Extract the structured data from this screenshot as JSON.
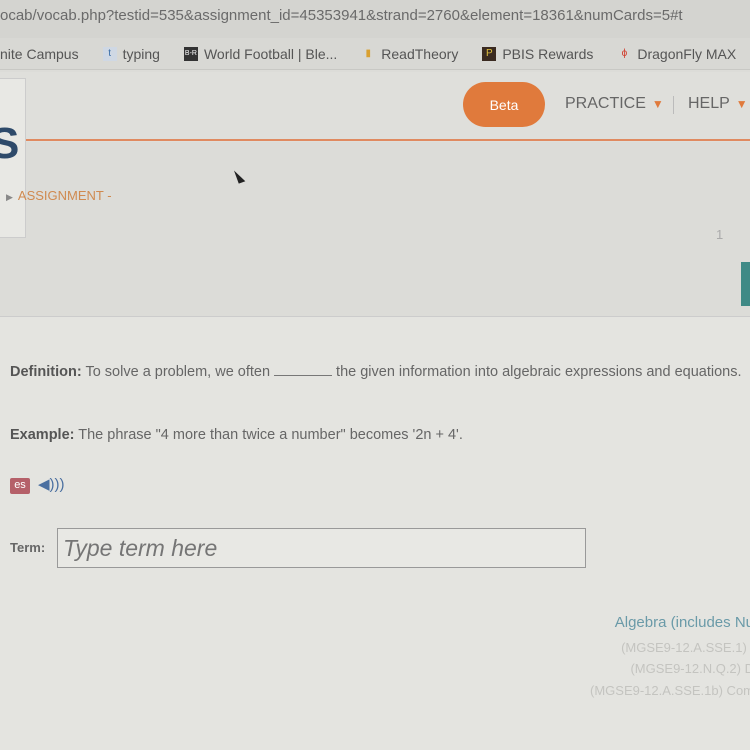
{
  "browser": {
    "url": "ocab/vocab.php?testid=535&assignment_id=45353941&strand=2760&element=18361&numCards=5#t",
    "bookmarks": [
      {
        "label": "nite Campus",
        "icon": ""
      },
      {
        "label": "typing",
        "icon": "t"
      },
      {
        "label": "World Football | Ble...",
        "icon": "B-R"
      },
      {
        "label": "ReadTheory",
        "icon": "bar-chart"
      },
      {
        "label": "PBIS Rewards",
        "icon": "P"
      },
      {
        "label": "DragonFly MAX",
        "icon": "flame"
      }
    ]
  },
  "header": {
    "logo": "S",
    "beta": "Beta",
    "practice": "PRACTICE",
    "help": "HELP",
    "accent": "#e07a3c"
  },
  "breadcrumb": "ASSIGNMENT -",
  "page_number": "1",
  "card": {
    "definition_label": "Definition:",
    "definition_before": "To solve a problem, we often",
    "definition_after": "the given information into algebraic expressions and equations.",
    "example_label": "Example:",
    "example_text": "The phrase \"4 more than twice a number\" becomes '2n + 4'.",
    "es_label": "es",
    "term_label": "Term:",
    "term_placeholder": "Type term here",
    "term_value": ""
  },
  "standards": {
    "title": "Algebra (includes Nu",
    "items": [
      "(MGSE9-12.A.SSE.1) I",
      "(MGSE9-12.N.Q.2) D",
      "(MGSE9-12.A.SSE.1b) Com"
    ]
  }
}
